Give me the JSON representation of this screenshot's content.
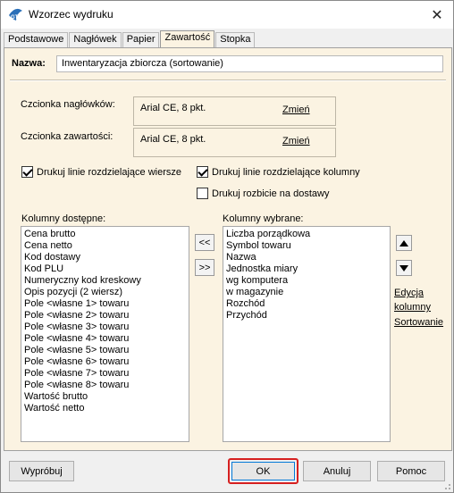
{
  "window": {
    "title": "Wzorzec wydruku"
  },
  "tabs": [
    {
      "label": "Podstawowe"
    },
    {
      "label": "Nagłówek"
    },
    {
      "label": "Papier"
    },
    {
      "label": "Zawartość",
      "active": true
    },
    {
      "label": "Stopka"
    }
  ],
  "name": {
    "label": "Nazwa:",
    "value": "Inwentaryzacja zbiorcza (sortowanie)"
  },
  "fonts": {
    "header": {
      "label": "Czcionka nagłówków:",
      "value": "Arial CE, 8 pkt.",
      "change": "Zmień"
    },
    "content": {
      "label": "Czcionka zawartości:",
      "value": "Arial CE, 8 pkt.",
      "change": "Zmień"
    }
  },
  "checkboxes": {
    "row_lines": {
      "label": "Drukuj linie rozdzielające wiersze",
      "checked": true
    },
    "col_lines": {
      "label": "Drukuj linie rozdzielające kolumny",
      "checked": true
    },
    "delivery_split": {
      "label": "Drukuj rozbicie na dostawy",
      "checked": false
    }
  },
  "available": {
    "label": "Kolumny dostępne:",
    "items": [
      "Cena brutto",
      "Cena netto",
      "Kod dostawy",
      "Kod PLU",
      "Numeryczny kod kreskowy",
      "Opis pozycji (2 wiersz)",
      "Pole <własne 1> towaru",
      "Pole <własne 2> towaru",
      "Pole <własne 3> towaru",
      "Pole <własne 4> towaru",
      "Pole <własne 5> towaru",
      "Pole <własne 6> towaru",
      "Pole <własne 7> towaru",
      "Pole <własne 8> towaru",
      "Wartość brutto",
      "Wartość netto"
    ]
  },
  "selected": {
    "label": "Kolumny wybrane:",
    "items": [
      "Liczba porządkowa",
      "Symbol towaru",
      "Nazwa",
      "Jednostka miary",
      "wg komputera",
      "w magazynie",
      "Rozchód",
      "Przychód"
    ]
  },
  "move": {
    "left": "<<",
    "right": ">>"
  },
  "links": {
    "edit_line1": "Edycja",
    "edit_line2": "kolumny",
    "sort": "Sortowanie"
  },
  "buttons": {
    "test": "Wypróbuj",
    "ok": "OK",
    "cancel": "Anuluj",
    "help": "Pomoc"
  },
  "colors": {
    "panel_bg": "#fbf3e2",
    "highlight": "#d62020"
  }
}
